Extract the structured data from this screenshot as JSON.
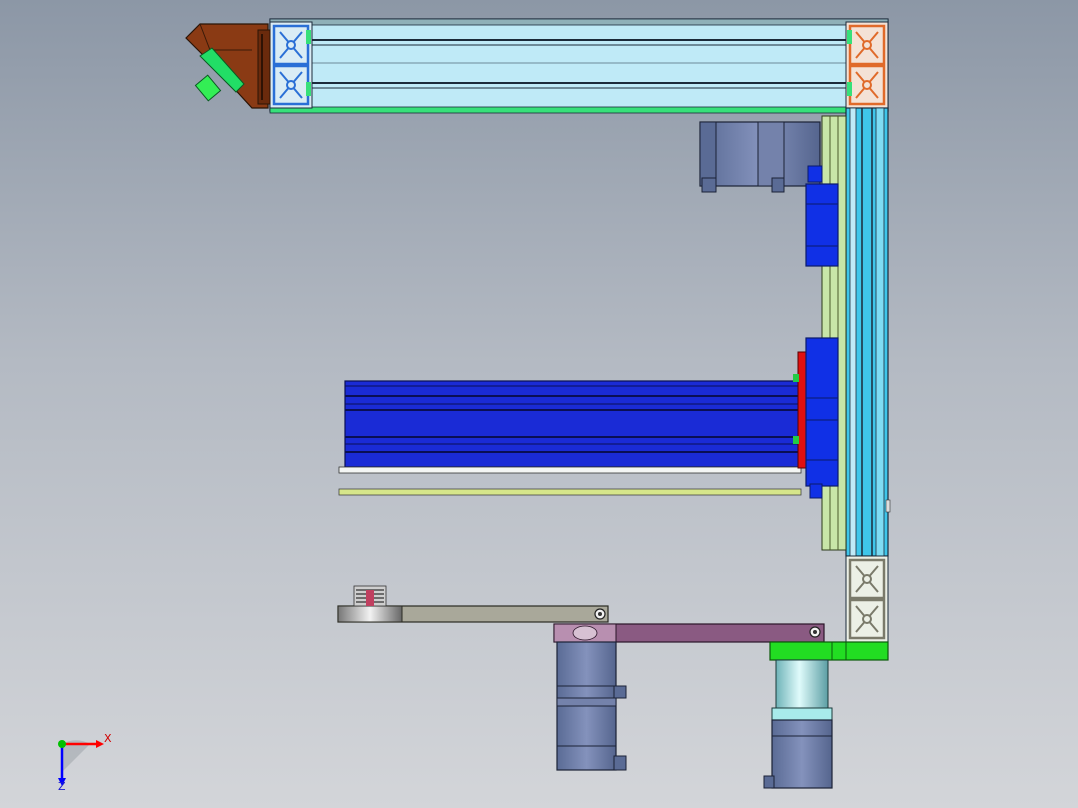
{
  "viewport": {
    "background_top": "#8c97a6",
    "background_bottom": "#d3d5d9"
  },
  "triad": {
    "x_label": "X",
    "z_label": "Z",
    "x_color": "#ff0000",
    "y_color": "#00c000",
    "z_color": "#0000ff"
  },
  "colors": {
    "extrusion_light": "#bfeaf7",
    "extrusion_cyan": "#3fc6ea",
    "extrusion_rail": "#c8e6a8",
    "stepper_motor": "#6e7fa8",
    "linear_module": "#1a2bd6",
    "carriage_block": "#1030e6",
    "bracket_brown": "#8a3a14",
    "arm_grey": "#a9a89a",
    "arm_purple": "#8a5a82",
    "coupler_green": "#22dd22",
    "coupler_cyan": "#a8eaea",
    "mount_red": "#e01010"
  }
}
